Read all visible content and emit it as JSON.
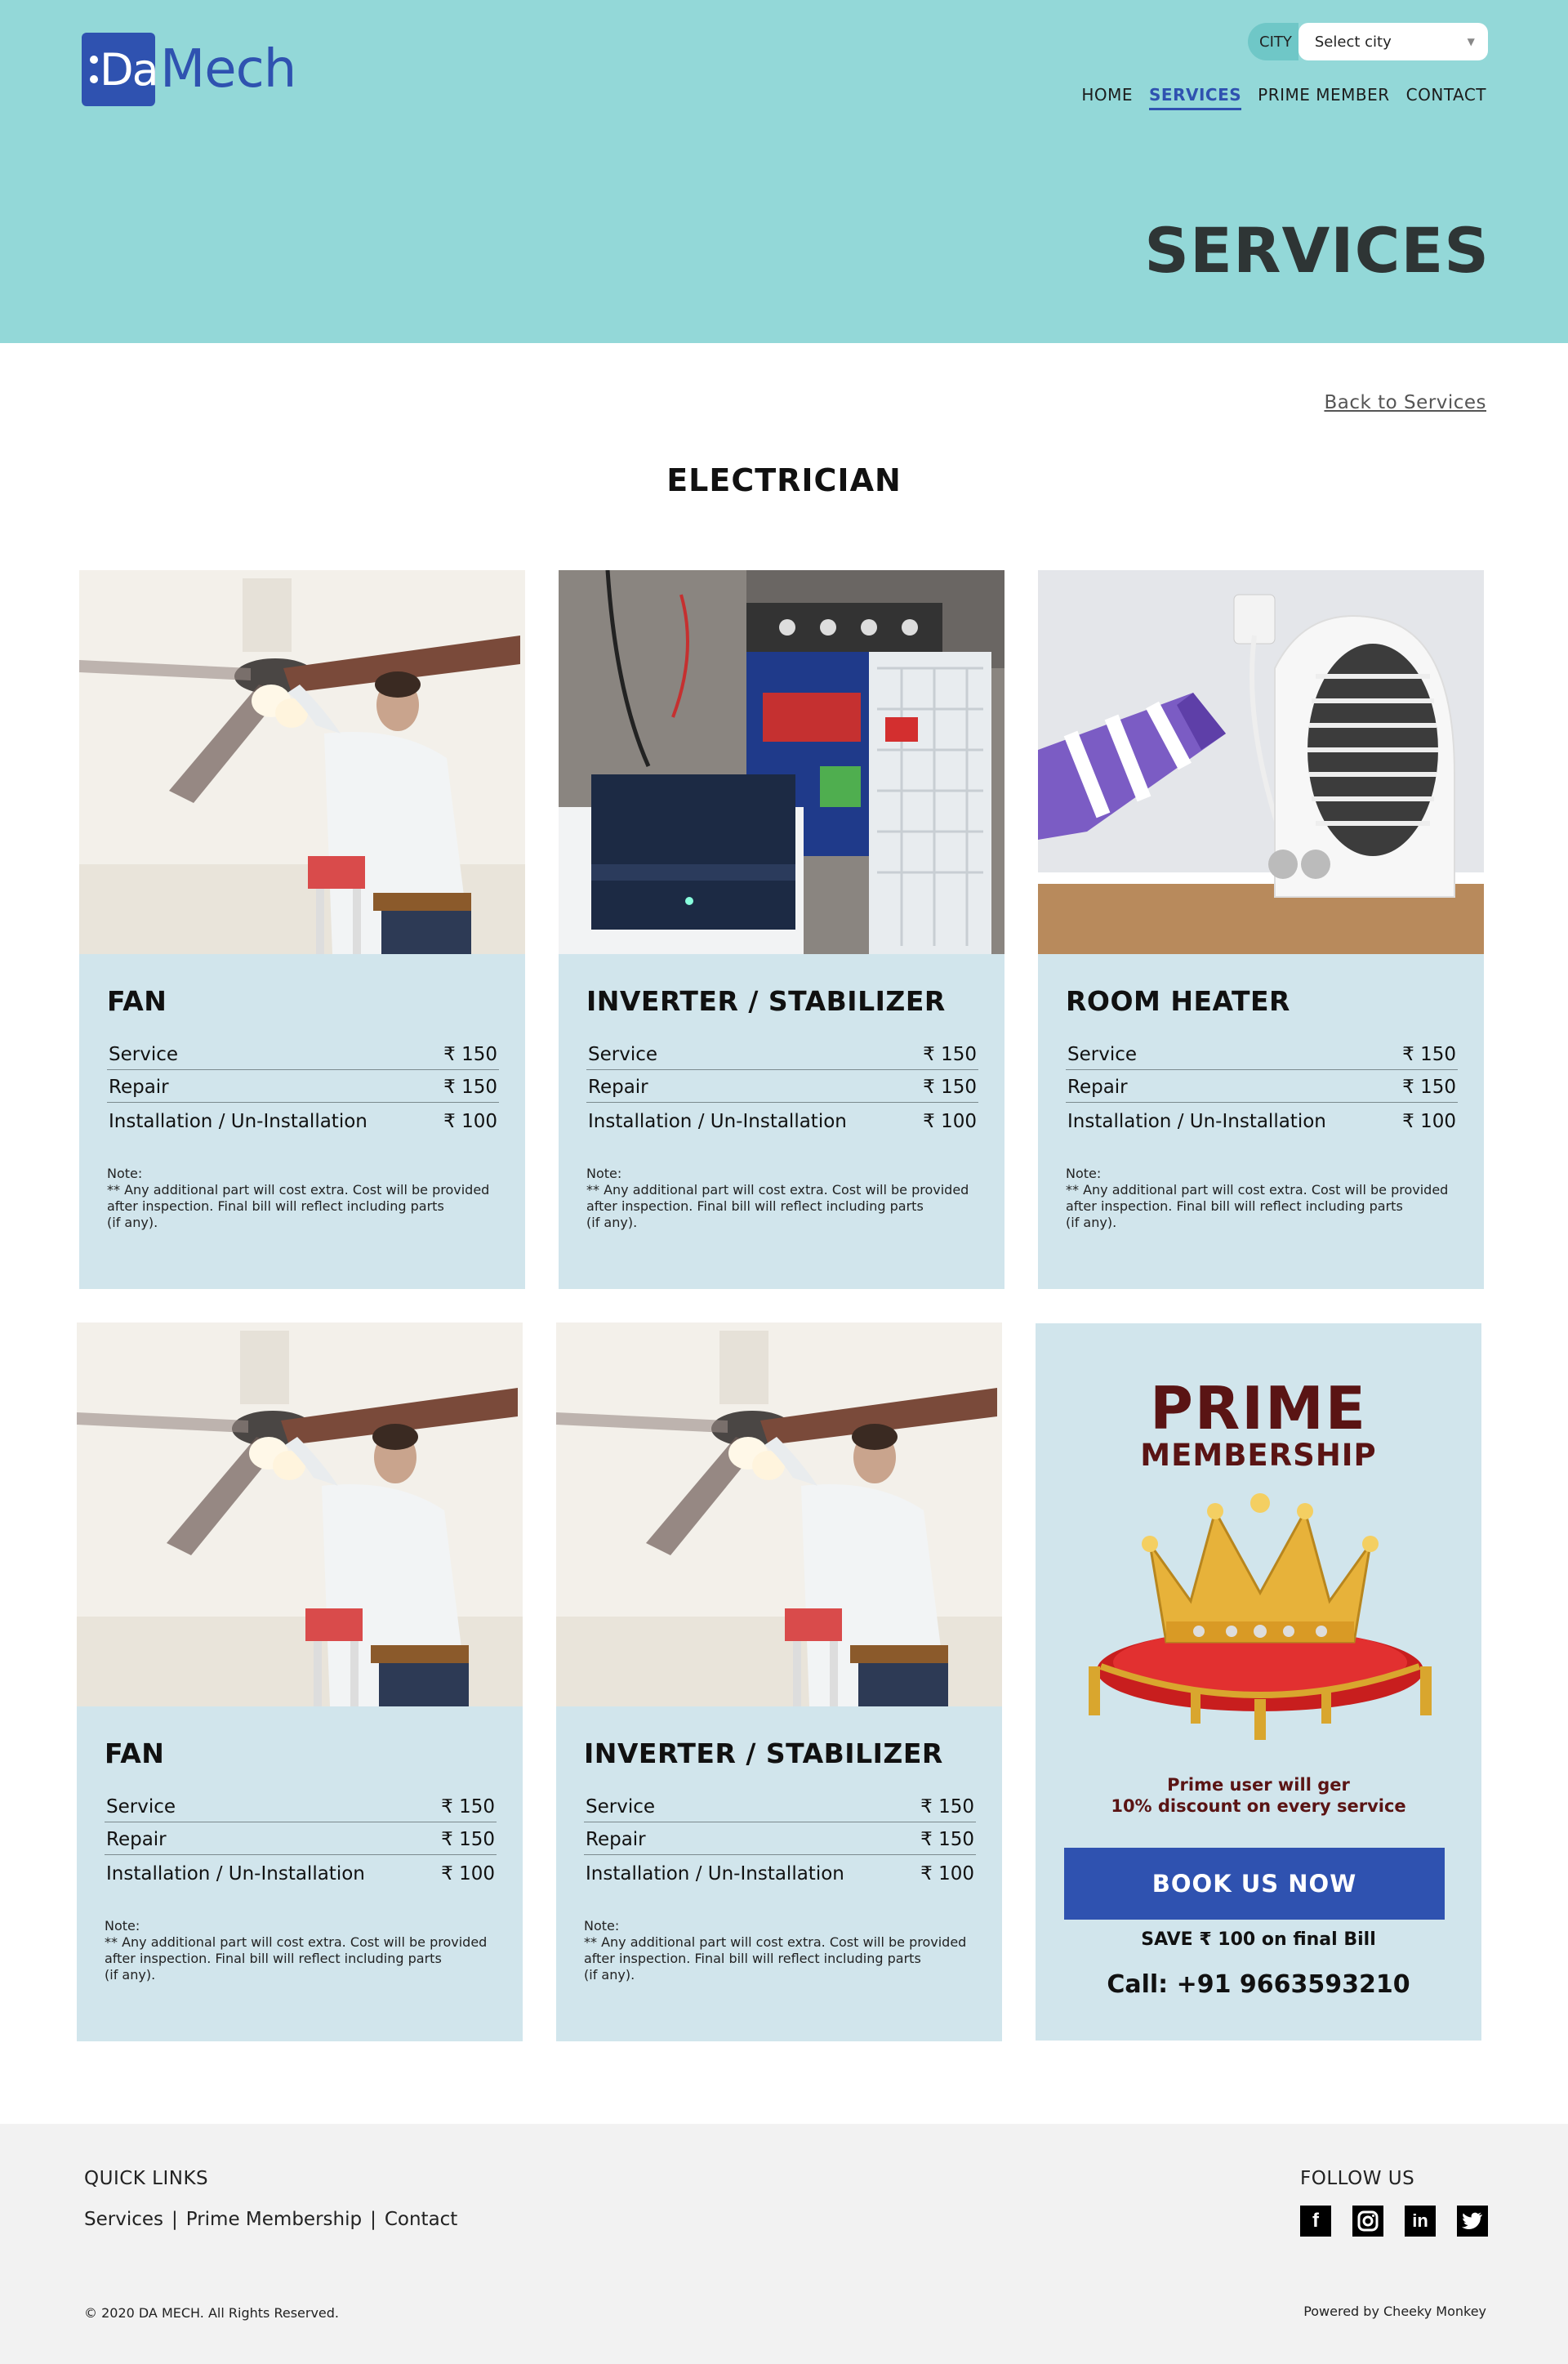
{
  "brand": {
    "logo_mark": ":Da",
    "logo_name": "Mech"
  },
  "city": {
    "label": "CITY",
    "selected": "Select city"
  },
  "nav": {
    "items": [
      "HOME",
      "SERVICES",
      "PRIME MEMBER",
      "CONTACT"
    ],
    "active": "SERVICES"
  },
  "page_title": "SERVICES",
  "back_link": "Back to Services",
  "section_title": "ELECTRICIAN",
  "price_labels": {
    "service": "Service",
    "repair": "Repair",
    "install": "Installation / Un-Installation"
  },
  "cards": [
    {
      "title": "FAN",
      "image": "ceiling-fan-repair-photo",
      "service": "₹ 150",
      "repair": "₹ 150",
      "install": "₹ 100"
    },
    {
      "title": "INVERTER / STABILIZER",
      "image": "inverter-battery-photo",
      "service": "₹ 150",
      "repair": "₹ 150",
      "install": "₹ 100"
    },
    {
      "title": "ROOM HEATER",
      "image": "room-heater-photo",
      "service": "₹ 150",
      "repair": "₹ 150",
      "install": "₹ 100"
    },
    {
      "title": "FAN",
      "image": "ceiling-fan-repair-photo",
      "service": "₹ 150",
      "repair": "₹ 150",
      "install": "₹ 100"
    },
    {
      "title": "INVERTER / STABILIZER",
      "image": "ceiling-fan-repair-photo",
      "service": "₹ 150",
      "repair": "₹ 150",
      "install": "₹ 100"
    }
  ],
  "note": {
    "heading": "Note:",
    "line1": "** Any additional part will cost extra.  Cost will be provided",
    "line2": "after inspection.  Final bill will reflect including parts",
    "line3": "(if any)."
  },
  "prime": {
    "title": "PRIME",
    "subtitle": "MEMBERSHIP",
    "desc_line1": "Prime user will ger",
    "desc_line2": "10% discount on every service",
    "button": "BOOK US NOW",
    "save": "SAVE ₹ 100  on final Bill",
    "call": "Call: +91 9663593210",
    "title_color": "#5a1414",
    "button_color": "#2f52b0"
  },
  "footer": {
    "quick_links_title": "QUICK LINKS",
    "links": [
      "Services",
      "Prime Membership",
      "Contact"
    ],
    "follow_title": "FOLLOW US",
    "socials": [
      "facebook-icon",
      "instagram-icon",
      "linkedin-icon",
      "twitter-icon"
    ],
    "copyright": "© 2020 DA MECH. All Rights Reserved.",
    "powered": "Powered by Cheeky Monkey"
  },
  "colors": {
    "header_bg": "#93d8d8",
    "card_bg": "#d1e5ec",
    "brand_blue": "#2f52b0",
    "footer_bg": "#f2f2f2"
  }
}
